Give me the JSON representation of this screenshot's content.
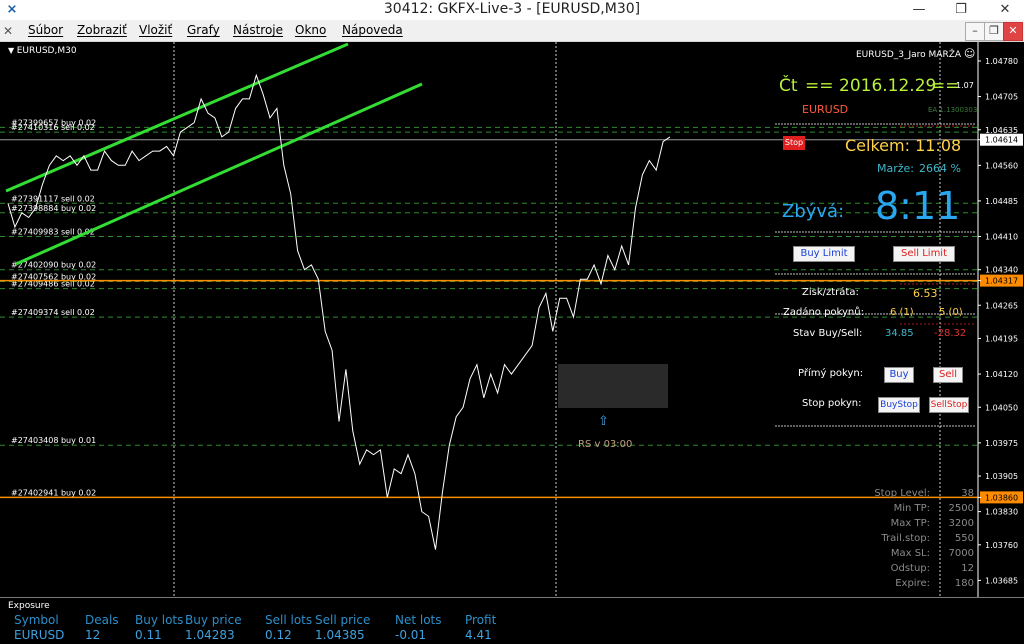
{
  "window": {
    "title": "30412: GKFX-Live-3 - [EURUSD,M30]",
    "minimize_glyph": "—",
    "restore_glyph": "❐",
    "close_glyph": "✕",
    "mdi_minimize_glyph": "–",
    "mdi_restore_glyph": "❐",
    "mdi_close_glyph": "✕"
  },
  "menu": [
    "Súbor",
    "Zobraziť",
    "Vložiť",
    "Grafy",
    "Nástroje",
    "Okno",
    "Nápoveda"
  ],
  "chart": {
    "symbol_label": "EURUSD,M30",
    "indicator_label": "EURUSD_3_Jaro MARŽA",
    "price_axis": [
      "1.04780",
      "1.04705",
      "1.04635",
      "1.04614",
      "1.04560",
      "1.04485",
      "1.04410",
      "1.04340",
      "1.04317",
      "1.04265",
      "1.04195",
      "1.04120",
      "1.04050",
      "1.03975",
      "1.03905",
      "1.03860",
      "1.03830",
      "1.03760",
      "1.03685"
    ],
    "highlight_prices": {
      "current": "1.04614",
      "orange_upper": "1.04317",
      "orange_lower": "1.03860"
    },
    "colors": {
      "background": "#000000",
      "price_line": "#ffffff",
      "channel": "#33dd33",
      "order_line": "#2e8b2e",
      "orange_line": "#ff8c00"
    }
  },
  "chart_data": {
    "type": "line",
    "symbol": "EURUSD",
    "timeframe": "M30",
    "ylim": [
      1.0365,
      1.0482
    ],
    "price": [
      1.0448,
      1.0443,
      1.0446,
      1.0445,
      1.0447,
      1.0452,
      1.0456,
      1.0458,
      1.0457,
      1.0458,
      1.0456,
      1.0458,
      1.0455,
      1.0455,
      1.0459,
      1.0457,
      1.0456,
      1.0456,
      1.0459,
      1.0457,
      1.0458,
      1.0459,
      1.0459,
      1.046,
      1.0458,
      1.0463,
      1.0464,
      1.0465,
      1.047,
      1.0467,
      1.0466,
      1.0462,
      1.0463,
      1.0468,
      1.047,
      1.047,
      1.0475,
      1.0471,
      1.0466,
      1.0468,
      1.0456,
      1.045,
      1.0438,
      1.0434,
      1.0435,
      1.0432,
      1.0421,
      1.0417,
      1.0402,
      1.0413,
      1.04,
      1.0393,
      1.0396,
      1.0395,
      1.0396,
      1.0386,
      1.0392,
      1.0391,
      1.0395,
      1.0391,
      1.0383,
      1.0382,
      1.0375,
      1.0387,
      1.0397,
      1.0403,
      1.0405,
      1.0411,
      1.0414,
      1.0407,
      1.0412,
      1.0408,
      1.0414,
      1.0412,
      1.0414,
      1.0416,
      1.0418,
      1.0426,
      1.0429,
      1.0421,
      1.0428,
      1.0428,
      1.0424,
      1.0432,
      1.0432,
      1.0435,
      1.0431,
      1.0437,
      1.0434,
      1.0439,
      1.0435,
      1.0447,
      1.0454,
      1.0457,
      1.0455,
      1.0461,
      1.0462
    ],
    "orders": [
      {
        "label": "#27399657 buy 0.02",
        "price": 1.0464
      },
      {
        "label": "#27410316 sell 0.02",
        "price": 1.0463
      },
      {
        "label": "#27391117 sell 0.02",
        "price": 1.0448
      },
      {
        "label": "#27398884 buy 0.02",
        "price": 1.0446
      },
      {
        "label": "#27409983 sell 0.02",
        "price": 1.0441
      },
      {
        "label": "#27402090 buy 0.02",
        "price": 1.0434
      },
      {
        "label": "#27407562 buy 0.02",
        "price": 1.04315
      },
      {
        "label": "#27409486 sell 0.02",
        "price": 1.043
      },
      {
        "label": "#27409374 sell 0.02",
        "price": 1.0424
      },
      {
        "label": "#27403408 buy 0.01",
        "price": 1.0397
      },
      {
        "label": "#27402941 buy 0.02",
        "price": 1.0386
      }
    ]
  },
  "panel": {
    "day_label": "Čt",
    "eq_left": "==",
    "date": "2016.12.29",
    "eq_right": "==",
    "version": "1.07",
    "symbol": "EURUSD",
    "ea_label": "EA 1.1300303",
    "stop_button": "Stop",
    "total_label": "Celkem: 11:08",
    "margin_label": "Marže:",
    "margin_value": "2664 %",
    "remaining_label": "Zbývá:",
    "remaining_time": "8:11",
    "buy_limit": "Buy Limit",
    "sell_limit": "Sell Limit",
    "pnl_label": "Zisk/ztráta:",
    "pnl_value": "6.53",
    "orders_label": "Zadáno pokynů:",
    "orders_buy": "6 (1)",
    "orders_sell": "5 (0)",
    "state_label": "Stav Buy/Sell:",
    "state_buy": "34.85",
    "state_sell": "-28.32",
    "direct_label": "Přímý pokyn:",
    "buy_btn": "Buy",
    "sell_btn": "Sell",
    "stop_order_label": "Stop pokyn:",
    "buystop_btn": "BuyStop",
    "sellstop_btn": "SellStop",
    "rs_arrow": "⇧",
    "rs_label": "RS v 03:00",
    "stats": [
      {
        "label": "Stop Level:",
        "value": "38"
      },
      {
        "label": "Min TP:",
        "value": "2500"
      },
      {
        "label": "Max TP:",
        "value": "3200"
      },
      {
        "label": "Trail.stop:",
        "value": "550"
      },
      {
        "label": "Max SL:",
        "value": "7000"
      },
      {
        "label": "Odstup:",
        "value": "12"
      },
      {
        "label": "Expire:",
        "value": "180"
      }
    ],
    "colors": {
      "date": "#b9f03a",
      "total": "#ffd24a",
      "big_time": "#2aa7f0",
      "symbol": "#ff5a3c"
    }
  },
  "exposure": {
    "title": "Exposure",
    "headers": [
      "Symbol",
      "Deals",
      "Buy lots",
      "Buy price",
      "Sell lots",
      "Sell price",
      "Net lots",
      "Profit"
    ],
    "row": [
      "EURUSD",
      "12",
      "0.11",
      "1.04283",
      "0.12",
      "1.04385",
      "-0.01",
      "4.41"
    ]
  }
}
